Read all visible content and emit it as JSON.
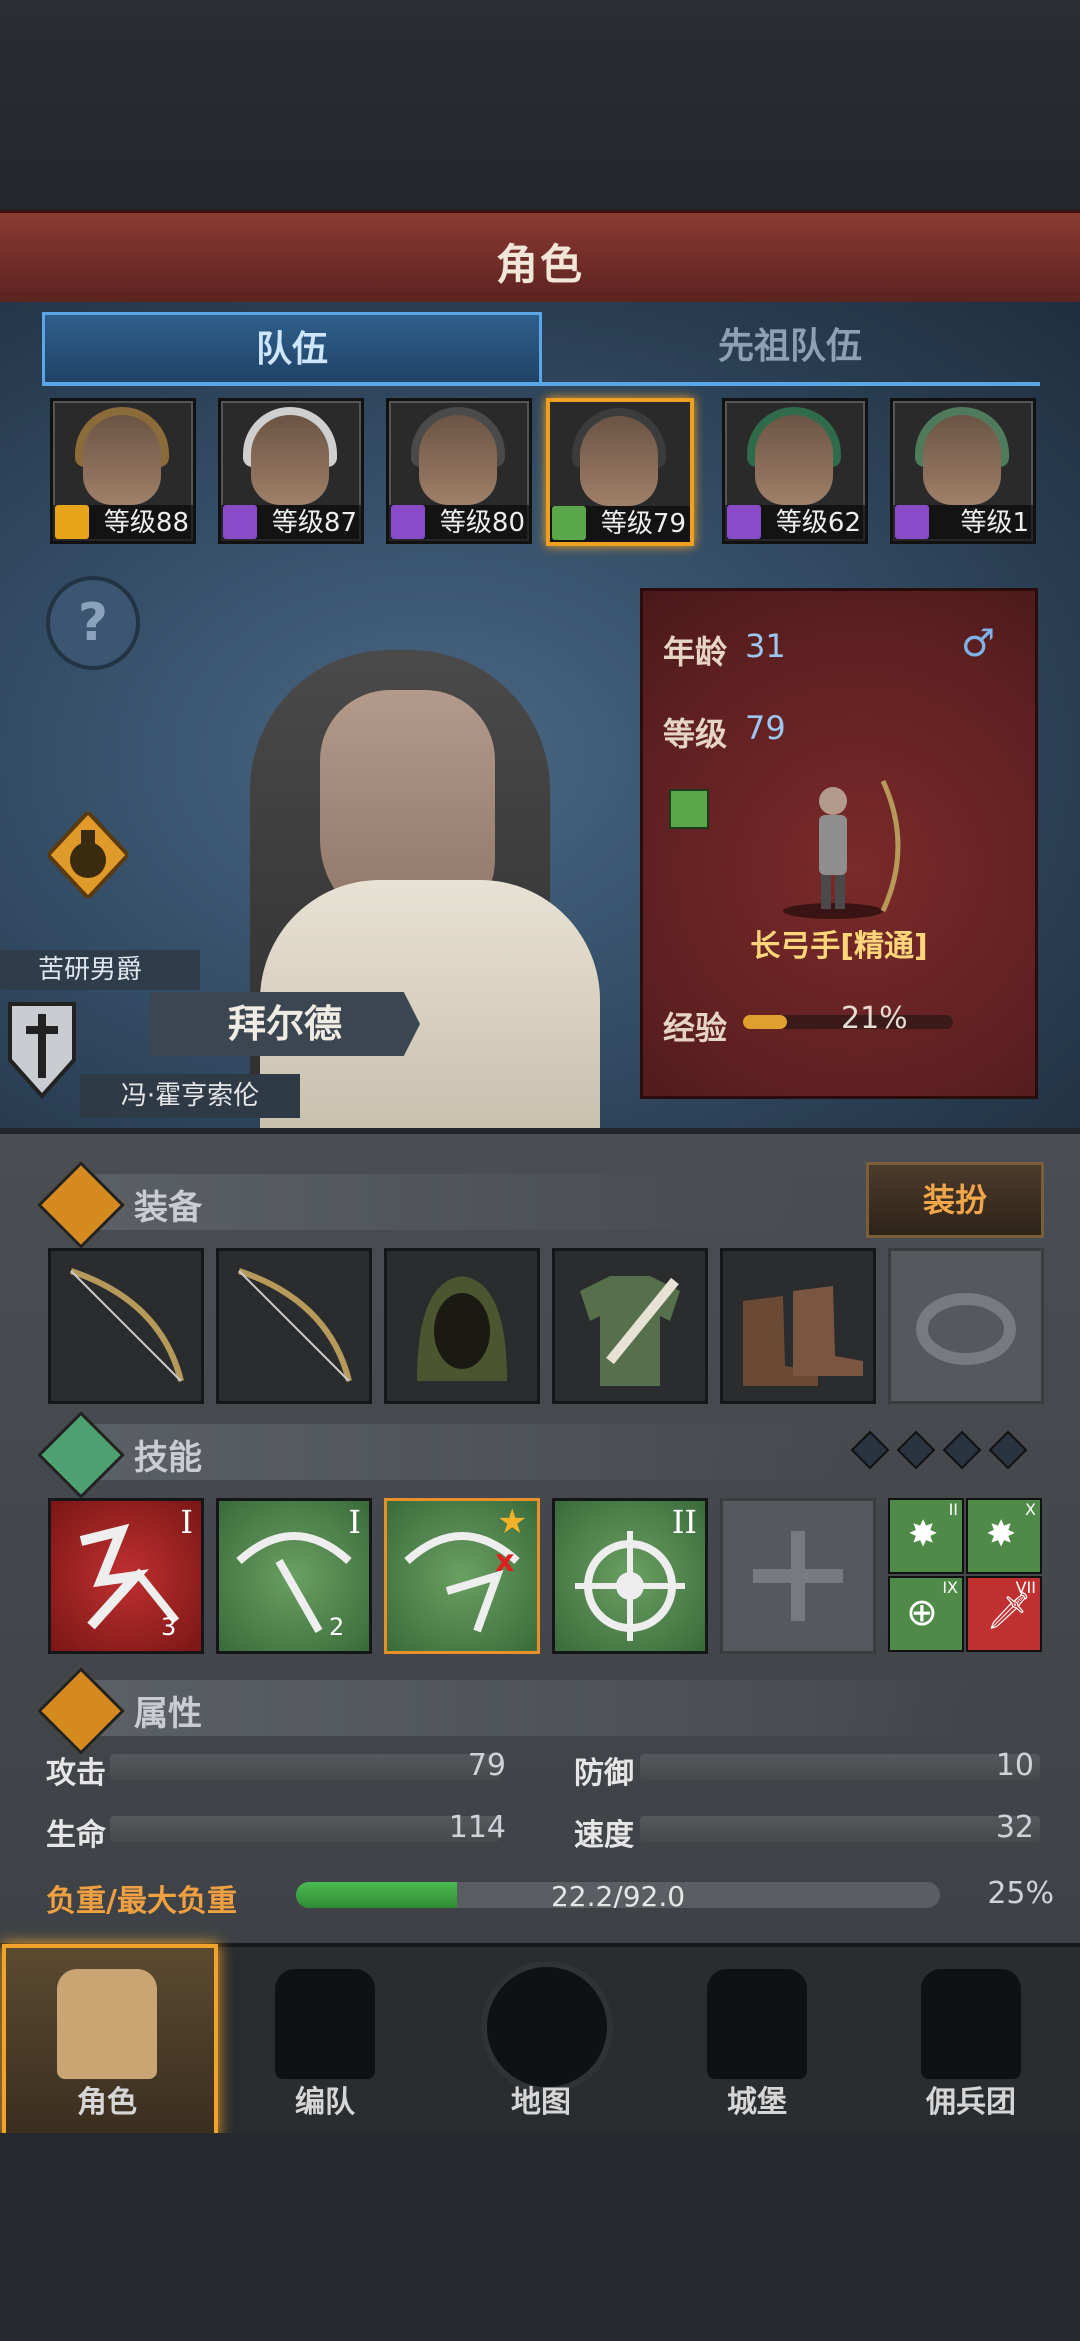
{
  "header": {
    "title": "角色"
  },
  "tabs": [
    {
      "label": "队伍",
      "active": true
    },
    {
      "label": "先祖队伍",
      "active": false
    }
  ],
  "party": [
    {
      "level_text": "等级88",
      "class_color": "#e8a51c",
      "hair": "#8b6b3a"
    },
    {
      "level_text": "等级87",
      "class_color": "#8a4bc9",
      "hair": "#cfcfcf"
    },
    {
      "level_text": "等级80",
      "class_color": "#8a4bc9",
      "hair": "#4a4a4a"
    },
    {
      "level_text": "等级79",
      "class_color": "#5aa64a",
      "hair": "#3c3c3c",
      "selected": true
    },
    {
      "level_text": "等级62",
      "class_color": "#8a4bc9",
      "hair": "#2f6b4a"
    },
    {
      "level_text": "等级1",
      "class_color": "#8a4bc9",
      "hair": "#4f7b5c"
    }
  ],
  "help": {
    "symbol": "?"
  },
  "hero": {
    "title": "苦研男爵",
    "name": "拜尔德",
    "family": "冯·霍亨索伦"
  },
  "card": {
    "age_label": "年龄",
    "age": "31",
    "gender_symbol": "♂",
    "level_label": "等级",
    "level": "79",
    "job": "长弓手[精通]",
    "exp_label": "经验",
    "exp_percent_text": "21%",
    "exp_fraction": 0.21
  },
  "equipment": {
    "title": "装备",
    "costume_label": "装扮",
    "slots": [
      "bow",
      "bow",
      "hood",
      "tunic",
      "boots",
      "ring-empty"
    ]
  },
  "skills": {
    "title": "技能",
    "ranks": [
      "I",
      "I",
      "",
      "II"
    ],
    "badges": [
      "3",
      "2",
      "",
      ""
    ],
    "mini_ranks": [
      "II",
      "X",
      "IX",
      "VII"
    ]
  },
  "attributes": {
    "title": "属性",
    "attack_label": "攻击",
    "attack": "79",
    "defense_label": "防御",
    "defense": "10",
    "hp_label": "生命",
    "hp": "114",
    "speed_label": "速度",
    "speed": "32",
    "load_label": "负重/最大负重",
    "load_value": "22.2/92.0",
    "load_percent": "25%",
    "load_fraction": 0.25
  },
  "nav": [
    {
      "label": "角色",
      "active": true
    },
    {
      "label": "编队",
      "active": false
    },
    {
      "label": "地图",
      "active": false
    },
    {
      "label": "城堡",
      "active": false
    },
    {
      "label": "佣兵团",
      "active": false
    }
  ],
  "colors": {
    "accent": "#f1a32a",
    "tab_blue": "#5aa6e6",
    "card_red": "#5c1f20"
  }
}
